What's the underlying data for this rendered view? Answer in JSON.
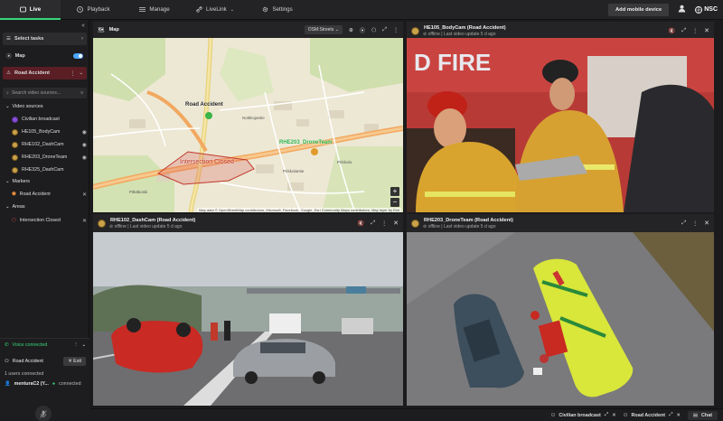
{
  "nav": {
    "tabs": [
      {
        "label": "Live"
      },
      {
        "label": "Playback"
      },
      {
        "label": "Manage"
      },
      {
        "label": "LiveLink"
      },
      {
        "label": "Settings"
      }
    ],
    "add_mobile_device": "Add mobile device",
    "brand": "NSC"
  },
  "sidebar": {
    "select_tasks": "Select tasks",
    "map_label": "Map",
    "map_toggle_on": true,
    "incident": "Road Accident",
    "search_placeholder": "Search video sources...",
    "video_sources_header": "Video sources",
    "sources": [
      {
        "name": "Civilian broadcast",
        "kind": "broadcast"
      },
      {
        "name": "HE105_BodyCam",
        "kind": "cam",
        "visible": true
      },
      {
        "name": "RHE102_DashCam",
        "kind": "cam",
        "visible": true
      },
      {
        "name": "RHE203_DroneTeam",
        "kind": "cam",
        "visible": true
      },
      {
        "name": "RHE325_DashCam",
        "kind": "cam",
        "visible": false
      }
    ],
    "markers_header": "Markers",
    "markers": [
      {
        "name": "Road Accident"
      }
    ],
    "areas_header": "Areas",
    "areas": [
      {
        "name": "Intersection Closed"
      }
    ]
  },
  "voice": {
    "status": "Voice connected",
    "channel": "Road Accident",
    "exit": "Exit",
    "users_connected": "1 users connected",
    "user_name": "menturaC2 (Y...",
    "user_state": "connected"
  },
  "map_pane": {
    "title": "Map",
    "layer": "OSM:Streets",
    "label_accident": "Road Accident",
    "label_area": "Intersection Closed",
    "label_unit": "RHE203_DroneTeam",
    "street_1": "Nottikujantie",
    "street_2": "Pirkkolantie",
    "street_3": "Pirkkola",
    "street_4": "Pitkäkoski",
    "attribution": "Map data © OpenStreetMap contributors, Microsoft, Facebook, Google, Esri Community Maps contributors, Map layer by Esri",
    "zoom_in": "+",
    "zoom_out": "−"
  },
  "cams": [
    {
      "title": "HE105_BodyCam (Road Accident)",
      "status": "offline",
      "last_update": "Last video update 5 d ago"
    },
    {
      "title": "RHE102_DashCam (Road Accident)",
      "status": "offline",
      "last_update": "Last video update 5 d ago"
    },
    {
      "title": "RHE203_DroneTeam (Road Accident)",
      "status": "offline",
      "last_update": "Last video update 5 d ago"
    }
  ],
  "bottombar": {
    "broadcast": "Civilian broadcast",
    "incident": "Road Accident",
    "chat": "Chat"
  },
  "colors": {
    "accent_green": "#37d67a",
    "toggle_blue": "#4aa8ff",
    "incident_red": "#5a1e24"
  }
}
